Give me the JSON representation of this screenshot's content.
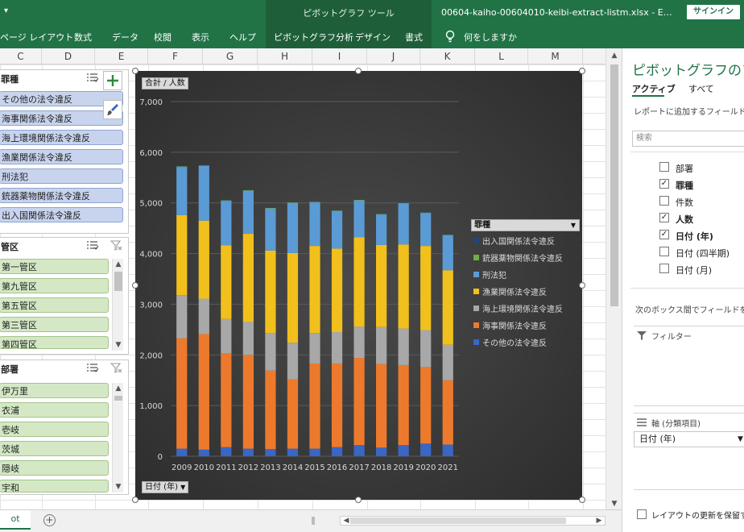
{
  "titlebar": {
    "contextual_title": "ピボットグラフ ツール",
    "filename": "00604-kaiho-00604010-keibi-extract-listm.xlsx  -  E…",
    "signin_label": "サインイン",
    "dropdown_glyph": "▾"
  },
  "ribbon": {
    "tabs": [
      "ページ レイアウト",
      "数式",
      "データ",
      "校閲",
      "表示",
      "ヘルプ",
      "ピボットグラフ分析",
      "デザイン",
      "書式"
    ],
    "tell_me": "何をしますか"
  },
  "columns": [
    "C",
    "D",
    "E",
    "F",
    "G",
    "H",
    "I",
    "J",
    "K",
    "L",
    "M"
  ],
  "slicers": {
    "crime": {
      "title": "罪種",
      "items": [
        "その他の法令違反",
        "海事関係法令違反",
        "海上環境関係法令違反",
        "漁業関係法令違反",
        "刑法犯",
        "銃器薬物関係法令違反",
        "出入国関係法令違反"
      ]
    },
    "district": {
      "title": "管区",
      "items": [
        "第一管区",
        "第九管区",
        "第五管区",
        "第三管区",
        "第四管区"
      ]
    },
    "department": {
      "title": "部署",
      "items": [
        "伊万里",
        "衣浦",
        "壱岐",
        "茨城",
        "隠岐",
        "宇和"
      ]
    }
  },
  "chart_field_buttons": {
    "values": "合計 / 人数",
    "axis": "日付 (年)"
  },
  "chart_data": {
    "type": "bar",
    "stacked": true,
    "categories": [
      "2009",
      "2010",
      "2011",
      "2012",
      "2013",
      "2014",
      "2015",
      "2016",
      "2017",
      "2018",
      "2019",
      "2020",
      "2021"
    ],
    "y_ticks": [
      "0",
      "1,000",
      "2,000",
      "3,000",
      "4,000",
      "5,000",
      "6,000",
      "7,000"
    ],
    "ylim": [
      0,
      7000
    ],
    "grid": true,
    "legend_title": "罪種",
    "legend_position": "right",
    "series": [
      {
        "name": "その他の法令違反",
        "color": "#3a66c4",
        "values": [
          150,
          130,
          180,
          150,
          140,
          150,
          150,
          180,
          220,
          170,
          220,
          250,
          230
        ]
      },
      {
        "name": "海事関係法令違反",
        "color": "#ed7a2c",
        "values": [
          2180,
          2280,
          1850,
          1850,
          1550,
          1370,
          1680,
          1650,
          1720,
          1650,
          1580,
          1510,
          1270
        ]
      },
      {
        "name": "海上環境関係法令違反",
        "color": "#a8a8a8",
        "values": [
          850,
          700,
          680,
          650,
          740,
          720,
          600,
          620,
          620,
          730,
          720,
          730,
          700
        ]
      },
      {
        "name": "漁業関係法令違反",
        "color": "#f2c01c",
        "values": [
          1580,
          1540,
          1450,
          1740,
          1630,
          1770,
          1720,
          1650,
          1760,
          1620,
          1660,
          1660,
          1470
        ]
      },
      {
        "name": "刑法犯",
        "color": "#5b9bd5",
        "values": [
          950,
          1080,
          880,
          850,
          830,
          990,
          860,
          740,
          730,
          600,
          810,
          650,
          690
        ]
      },
      {
        "name": "銃器薬物関係法令違反",
        "color": "#70ad47",
        "values": [
          10,
          10,
          10,
          10,
          10,
          10,
          10,
          10,
          10,
          10,
          10,
          10,
          10
        ]
      },
      {
        "name": "出入国関係法令違反",
        "color": "#264478",
        "values": [
          10,
          10,
          10,
          10,
          10,
          10,
          10,
          10,
          10,
          10,
          10,
          10,
          10
        ]
      }
    ]
  },
  "pane": {
    "title": "ピボットグラフのフィ",
    "tabs": [
      "アクティブ",
      "すべて"
    ],
    "hint": "レポートに追加するフィールドを選",
    "search_placeholder": "検索",
    "fields": [
      {
        "label": "部署",
        "checked": false
      },
      {
        "label": "罪種",
        "checked": true
      },
      {
        "label": "件数",
        "checked": false
      },
      {
        "label": "人数",
        "checked": true
      },
      {
        "label": "日付 (年)",
        "checked": true
      },
      {
        "label": "日付 (四半期)",
        "checked": false
      },
      {
        "label": "日付 (月)",
        "checked": false
      }
    ],
    "drag_hint": "次のボックス間でフィールドをドラ",
    "filter_label": "フィルター",
    "axis_label": "軸 (分類項目)",
    "axis_item": "日付 (年)",
    "defer_label": "レイアウトの更新を保留す"
  },
  "bottom": {
    "sheet_tab": "ot",
    "add_sheet": "+"
  }
}
